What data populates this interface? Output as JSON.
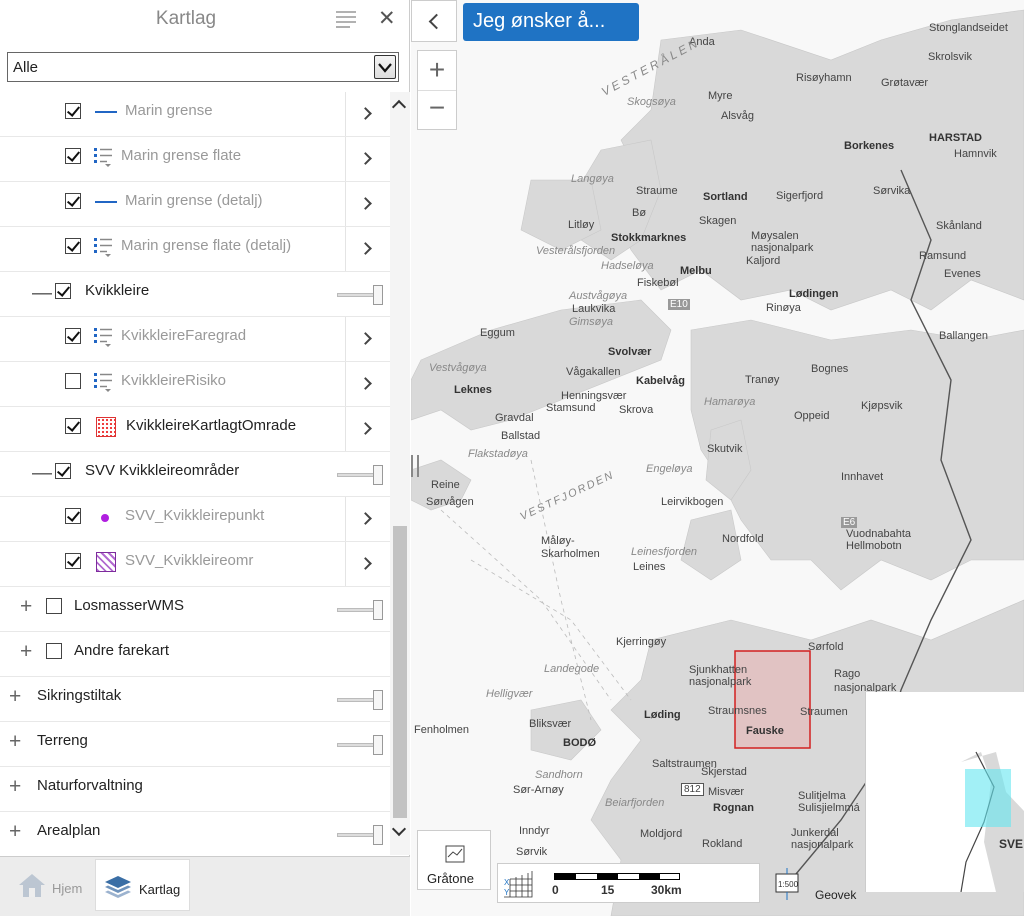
{
  "panel": {
    "title": "Kartlag",
    "filter_value": "Alle",
    "layers": [
      {
        "label": "Marin grense",
        "checked": true,
        "icon": "line-icon"
      },
      {
        "label": "Marin grense flate",
        "checked": true,
        "icon": "legend-list-icon"
      },
      {
        "label": "Marin grense (detalj)",
        "checked": true,
        "icon": "line-icon"
      },
      {
        "label": "Marin grense flate (detalj)",
        "checked": true,
        "icon": "legend-list-icon"
      },
      {
        "label": "Kvikkleire",
        "checked": true,
        "group": true
      },
      {
        "label": "KvikkleireFaregrad",
        "checked": true,
        "icon": "legend-list-icon"
      },
      {
        "label": "KvikkleireRisiko",
        "checked": false,
        "icon": "legend-list-icon"
      },
      {
        "label": "KvikkleireKartlagtOmrade",
        "checked": true,
        "icon": "dotted-area-icon"
      },
      {
        "label": "SVV Kvikkleireområder",
        "checked": true,
        "group": true
      },
      {
        "label": "SVV_Kvikkleirepunkt",
        "checked": true,
        "icon": "point-icon"
      },
      {
        "label": "SVV_Kvikkleireomr",
        "checked": true,
        "icon": "hatched-area-icon"
      },
      {
        "label": "LosmasserWMS",
        "checked": false,
        "group": true
      },
      {
        "label": "Andre farekart",
        "checked": false,
        "group": true
      },
      {
        "label": "Sikringstiltak"
      },
      {
        "label": "Terreng"
      },
      {
        "label": "Naturforvaltning"
      },
      {
        "label": "Arealplan"
      }
    ],
    "tabs": {
      "home": "Hjem",
      "layers": "Kartlag"
    }
  },
  "map": {
    "action_button": "Jeg ønsker å...",
    "zoom_in": "+",
    "zoom_out": "−",
    "basemap_label": "Gråtone",
    "scale": {
      "start": "0",
      "mid": "15",
      "end": "30km"
    },
    "attribution": "Geovek",
    "overview_label": "SVE",
    "labels": [
      {
        "t": "Anda",
        "s": "n"
      },
      {
        "t": "VESTERÅLEN",
        "s": "i"
      },
      {
        "t": "Stonglandseidet",
        "s": "n"
      },
      {
        "t": "Skrolsvik",
        "s": "n"
      },
      {
        "t": "Risøyhamn",
        "s": "n"
      },
      {
        "t": "Grøtavær",
        "s": "n"
      },
      {
        "t": "Myre",
        "s": "n"
      },
      {
        "t": "Skogsøya",
        "s": "i"
      },
      {
        "t": "Alsvåg",
        "s": "n"
      },
      {
        "t": "Stokkmarknes",
        "s": "b"
      },
      {
        "t": "Sortland",
        "s": "b"
      },
      {
        "t": "HARSTAD",
        "s": "b"
      },
      {
        "t": "Hamnvik",
        "s": "n"
      },
      {
        "t": "Borkenes",
        "s": "b"
      },
      {
        "t": "Langøya",
        "s": "i"
      },
      {
        "t": "Straume",
        "s": "n"
      },
      {
        "t": "Sigerfjord",
        "s": "n"
      },
      {
        "t": "Sørvika",
        "s": "n"
      },
      {
        "t": "Bø",
        "s": "n"
      },
      {
        "t": "Litløy",
        "s": "n"
      },
      {
        "t": "Skagen",
        "s": "n"
      },
      {
        "t": "Møysalen nasjonalpark",
        "s": "n"
      },
      {
        "t": "Skånland",
        "s": "n"
      },
      {
        "t": "Vesterålsfjorden",
        "s": "i"
      },
      {
        "t": "Hadseløya",
        "s": "i"
      },
      {
        "t": "Melbu",
        "s": "b"
      },
      {
        "t": "Kaljord",
        "s": "n"
      },
      {
        "t": "Ramsund",
        "s": "n"
      },
      {
        "t": "Evenes",
        "s": "n"
      },
      {
        "t": "Fiskebøl",
        "s": "n"
      },
      {
        "t": "Lødingen",
        "s": "b"
      },
      {
        "t": "Austvågøya",
        "s": "i"
      },
      {
        "t": "Laukvika",
        "s": "n"
      },
      {
        "t": "Gimsøya",
        "s": "i"
      },
      {
        "t": "Rinøya",
        "s": "n"
      },
      {
        "t": "Ballangen",
        "s": "n"
      },
      {
        "t": "Eggum",
        "s": "n"
      },
      {
        "t": "Svolvær",
        "s": "b"
      },
      {
        "t": "Vestvågøya",
        "s": "i"
      },
      {
        "t": "Vågakallen",
        "s": "n"
      },
      {
        "t": "Kabelvåg",
        "s": "b"
      },
      {
        "t": "Bognes",
        "s": "n"
      },
      {
        "t": "Leknes",
        "s": "b"
      },
      {
        "t": "Henningsvær",
        "s": "n"
      },
      {
        "t": "Stamsund",
        "s": "n"
      },
      {
        "t": "Skrova",
        "s": "n"
      },
      {
        "t": "Tranøy",
        "s": "n"
      },
      {
        "t": "Gravdal",
        "s": "n"
      },
      {
        "t": "Ballstad",
        "s": "n"
      },
      {
        "t": "Hamarøya",
        "s": "i"
      },
      {
        "t": "Oppeid",
        "s": "n"
      },
      {
        "t": "Kjøpsvik",
        "s": "n"
      },
      {
        "t": "Flakstadøya",
        "s": "i"
      },
      {
        "t": "Skutvik",
        "s": "n"
      },
      {
        "t": "Engeløya",
        "s": "i"
      },
      {
        "t": "Reine",
        "s": "n"
      },
      {
        "t": "Sørvågen",
        "s": "n"
      },
      {
        "t": "VESTFJORDEN",
        "s": "i"
      },
      {
        "t": "Leirvikbogen",
        "s": "n"
      },
      {
        "t": "Innhavet",
        "s": "n"
      },
      {
        "t": "Nordfold",
        "s": "n"
      },
      {
        "t": "Vuodnabahta Hellmobotn",
        "s": "n"
      },
      {
        "t": "Måløy-Skarholmen",
        "s": "n"
      },
      {
        "t": "Leinesfjorden",
        "s": "i"
      },
      {
        "t": "Leines",
        "s": "n"
      },
      {
        "t": "Kjerringøy",
        "s": "n"
      },
      {
        "t": "Sørfold",
        "s": "n"
      },
      {
        "t": "Landegode",
        "s": "i"
      },
      {
        "t": "Sjunkhatten nasjonalpark",
        "s": "n"
      },
      {
        "t": "Rago nasjonalpark",
        "s": "n"
      },
      {
        "t": "Helligvær",
        "s": "i"
      },
      {
        "t": "Løding",
        "s": "b"
      },
      {
        "t": "Straumsnes",
        "s": "n"
      },
      {
        "t": "Straumen",
        "s": "n"
      },
      {
        "t": "Bliksvær",
        "s": "n"
      },
      {
        "t": "Fenholmen",
        "s": "n"
      },
      {
        "t": "BODØ",
        "s": "b"
      },
      {
        "t": "Fauske",
        "s": "b"
      },
      {
        "t": "Saltstraumen",
        "s": "n"
      },
      {
        "t": "Sandhorn",
        "s": "i"
      },
      {
        "t": "Skjerstad",
        "s": "n"
      },
      {
        "t": "Sør-Arnøy",
        "s": "n"
      },
      {
        "t": "Misvær",
        "s": "n"
      },
      {
        "t": "Sulitjelma Sulisjielmmá",
        "s": "n"
      },
      {
        "t": "Rognan",
        "s": "b"
      },
      {
        "t": "Beiarfjorden",
        "s": "i"
      },
      {
        "t": "Inndyr",
        "s": "n"
      },
      {
        "t": "Moldjord",
        "s": "n"
      },
      {
        "t": "Junkerdal nasjonalpark",
        "s": "n"
      },
      {
        "t": "Rokland",
        "s": "n"
      },
      {
        "t": "Sørvik",
        "s": "n"
      },
      {
        "t": "E10",
        "s": "n"
      },
      {
        "t": "E6",
        "s": "n"
      },
      {
        "t": "812",
        "s": "n"
      }
    ]
  },
  "colors": {
    "accent": "#1f73c4",
    "line_icon": "#2166c4",
    "landmass": "#d9d9d9",
    "sea": "#f8f8f8",
    "area_highlight": "#e33333"
  }
}
